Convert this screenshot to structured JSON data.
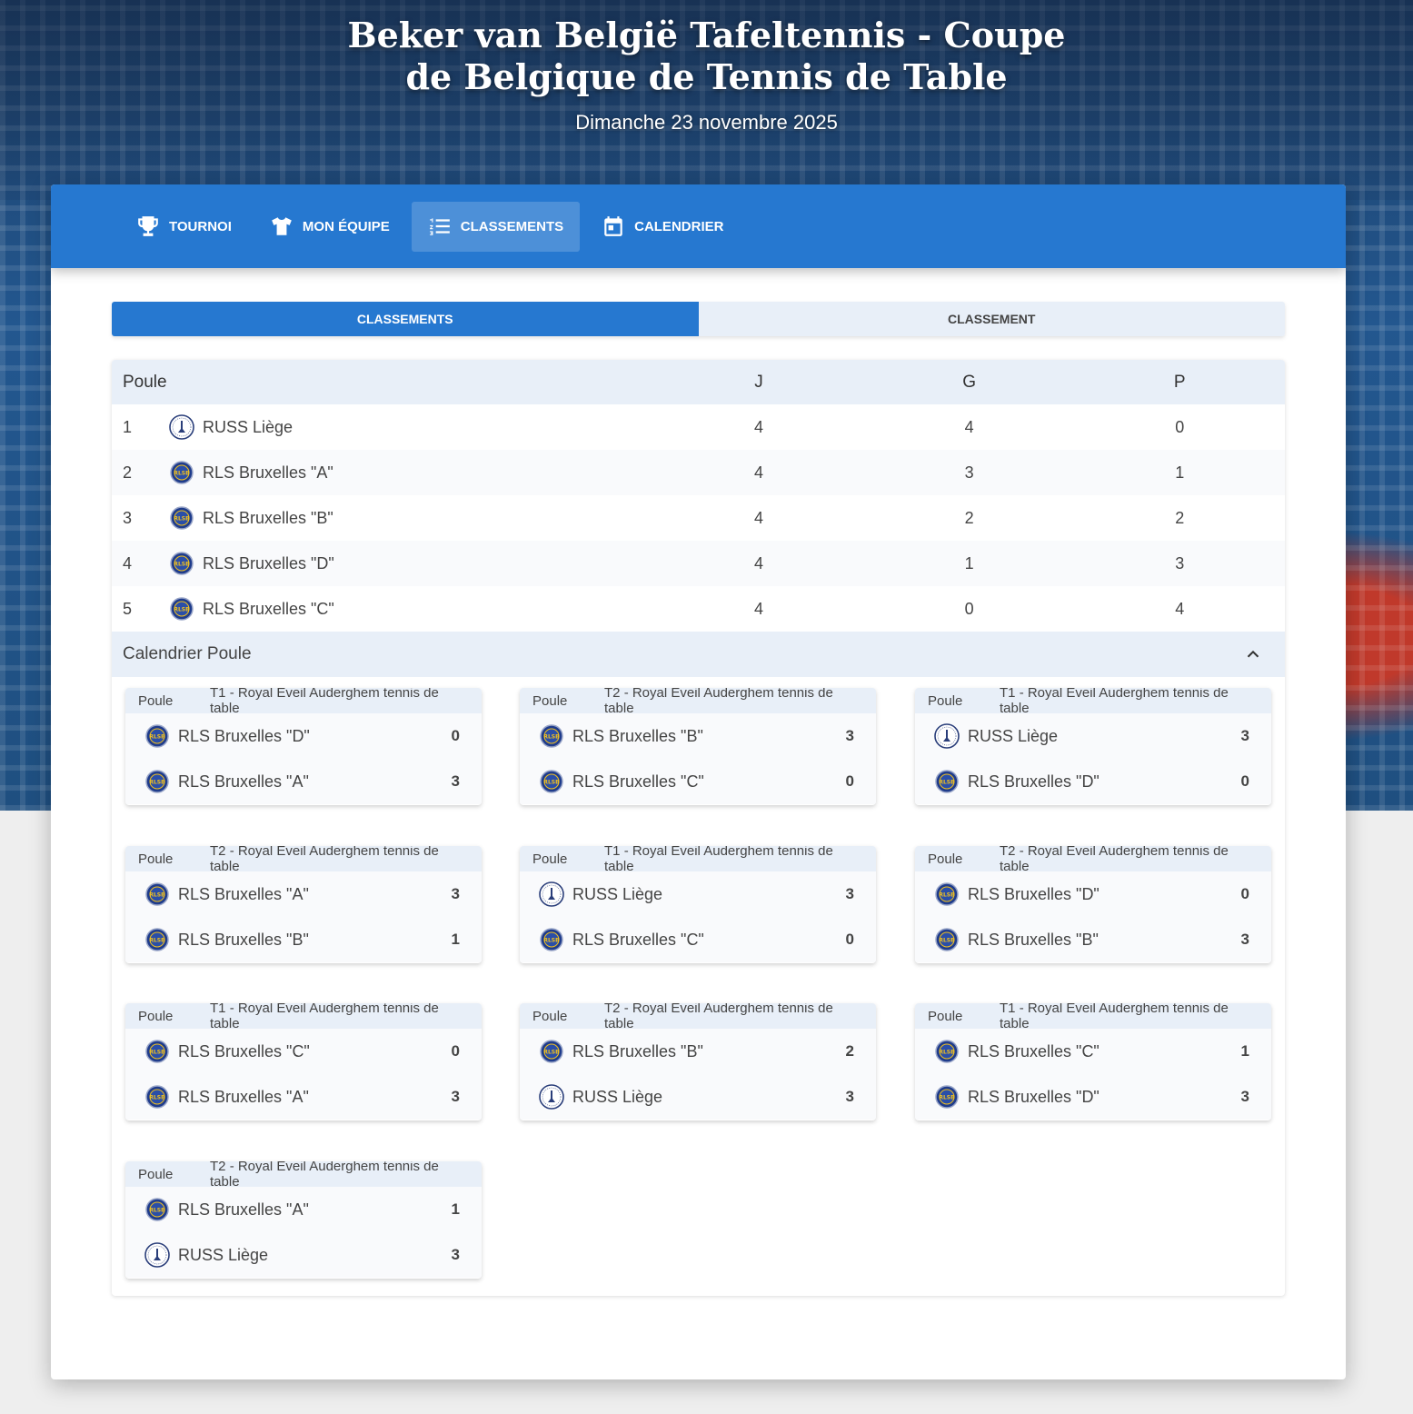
{
  "hero": {
    "title": "Beker van België Tafeltennis - Coupe de Belgique de Tennis de Table",
    "date": "Dimanche 23 novembre 2025"
  },
  "nav": [
    {
      "label": "TOURNOI",
      "icon": "trophy-icon"
    },
    {
      "label": "MON ÉQUIPE",
      "icon": "shirt-icon"
    },
    {
      "label": "CLASSEMENTS",
      "icon": "list-icon",
      "active": true
    },
    {
      "label": "CALENDRIER",
      "icon": "calendar-icon"
    }
  ],
  "subtabs": [
    {
      "label": "CLASSEMENTS",
      "active": true
    },
    {
      "label": "CLASSEMENT",
      "active": false
    }
  ],
  "standings": {
    "headers": {
      "name": "Poule",
      "j": "J",
      "g": "G",
      "p": "P"
    },
    "rows": [
      {
        "rank": "1",
        "team": "RUSS Liège",
        "logo": "russ",
        "j": "4",
        "g": "4",
        "p": "0"
      },
      {
        "rank": "2",
        "team": "RLS Bruxelles \"A\"",
        "logo": "rls",
        "j": "4",
        "g": "3",
        "p": "1"
      },
      {
        "rank": "3",
        "team": "RLS Bruxelles \"B\"",
        "logo": "rls",
        "j": "4",
        "g": "2",
        "p": "2"
      },
      {
        "rank": "4",
        "team": "RLS Bruxelles \"D\"",
        "logo": "rls",
        "j": "4",
        "g": "1",
        "p": "3"
      },
      {
        "rank": "5",
        "team": "RLS Bruxelles \"C\"",
        "logo": "rls",
        "j": "4",
        "g": "0",
        "p": "4"
      }
    ]
  },
  "calendar": {
    "title": "Calendrier Poule",
    "poule_label": "Poule",
    "matches": [
      {
        "table": "T1 - Royal Eveil Auderghem tennis de table",
        "home": "RLS Bruxelles \"D\"",
        "home_logo": "rls",
        "home_score": "0",
        "away": "RLS Bruxelles \"A\"",
        "away_logo": "rls",
        "away_score": "3"
      },
      {
        "table": "T2 - Royal Eveil Auderghem tennis de table",
        "home": "RLS Bruxelles \"B\"",
        "home_logo": "rls",
        "home_score": "3",
        "away": "RLS Bruxelles \"C\"",
        "away_logo": "rls",
        "away_score": "0"
      },
      {
        "table": "T1 - Royal Eveil Auderghem tennis de table",
        "home": "RUSS Liège",
        "home_logo": "russ",
        "home_score": "3",
        "away": "RLS Bruxelles \"D\"",
        "away_logo": "rls",
        "away_score": "0"
      },
      {
        "table": "T2 - Royal Eveil Auderghem tennis de table",
        "home": "RLS Bruxelles \"A\"",
        "home_logo": "rls",
        "home_score": "3",
        "away": "RLS Bruxelles \"B\"",
        "away_logo": "rls",
        "away_score": "1"
      },
      {
        "table": "T1 - Royal Eveil Auderghem tennis de table",
        "home": "RUSS Liège",
        "home_logo": "russ",
        "home_score": "3",
        "away": "RLS Bruxelles \"C\"",
        "away_logo": "rls",
        "away_score": "0"
      },
      {
        "table": "T2 - Royal Eveil Auderghem tennis de table",
        "home": "RLS Bruxelles \"D\"",
        "home_logo": "rls",
        "home_score": "0",
        "away": "RLS Bruxelles \"B\"",
        "away_logo": "rls",
        "away_score": "3"
      },
      {
        "table": "T1 - Royal Eveil Auderghem tennis de table",
        "home": "RLS Bruxelles \"C\"",
        "home_logo": "rls",
        "home_score": "0",
        "away": "RLS Bruxelles \"A\"",
        "away_logo": "rls",
        "away_score": "3"
      },
      {
        "table": "T2 - Royal Eveil Auderghem tennis de table",
        "home": "RLS Bruxelles \"B\"",
        "home_logo": "rls",
        "home_score": "2",
        "away": "RUSS Liège",
        "away_logo": "russ",
        "away_score": "3"
      },
      {
        "table": "T1 - Royal Eveil Auderghem tennis de table",
        "home": "RLS Bruxelles \"C\"",
        "home_logo": "rls",
        "home_score": "1",
        "away": "RLS Bruxelles \"D\"",
        "away_logo": "rls",
        "away_score": "3"
      },
      {
        "table": "T2 - Royal Eveil Auderghem tennis de table",
        "home": "RLS Bruxelles \"A\"",
        "home_logo": "rls",
        "home_score": "1",
        "away": "RUSS Liège",
        "away_logo": "russ",
        "away_score": "3"
      }
    ]
  },
  "colors": {
    "primary": "#2678d0",
    "header_bg": "#e8eff8"
  }
}
